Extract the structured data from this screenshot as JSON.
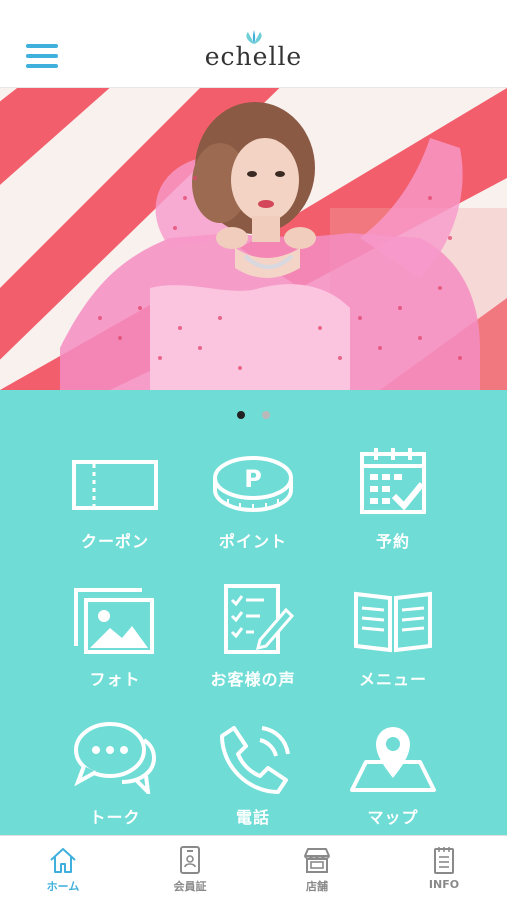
{
  "colors": {
    "accent": "#3fb0dc",
    "teal": "#6fdcd6",
    "coral": "#f25e6b",
    "tab_inactive": "#8a8a8a",
    "dot_active": "#222222",
    "dot_inactive": "#b9b9b9"
  },
  "header": {
    "logo_text": "echelle",
    "menu_icon": "hamburger-icon"
  },
  "hero": {
    "slides": 2,
    "active_slide": 1
  },
  "menu": [
    {
      "label": "クーポン",
      "icon": "ticket-icon"
    },
    {
      "label": "ポイント",
      "icon": "point-coin-icon"
    },
    {
      "label": "予約",
      "icon": "calendar-check-icon"
    },
    {
      "label": "フォト",
      "icon": "photo-icon"
    },
    {
      "label": "お客様の声",
      "icon": "clipboard-pen-icon"
    },
    {
      "label": "メニュー",
      "icon": "open-book-icon"
    },
    {
      "label": "トーク",
      "icon": "chat-bubbles-icon"
    },
    {
      "label": "電話",
      "icon": "phone-icon"
    },
    {
      "label": "マップ",
      "icon": "map-pin-icon"
    }
  ],
  "tabbar": [
    {
      "label": "ホーム",
      "icon": "home-icon",
      "active": true
    },
    {
      "label": "会員証",
      "icon": "member-card-icon",
      "active": false
    },
    {
      "label": "店舗",
      "icon": "store-icon",
      "active": false
    },
    {
      "label": "INFO",
      "icon": "info-document-icon",
      "active": false
    }
  ]
}
